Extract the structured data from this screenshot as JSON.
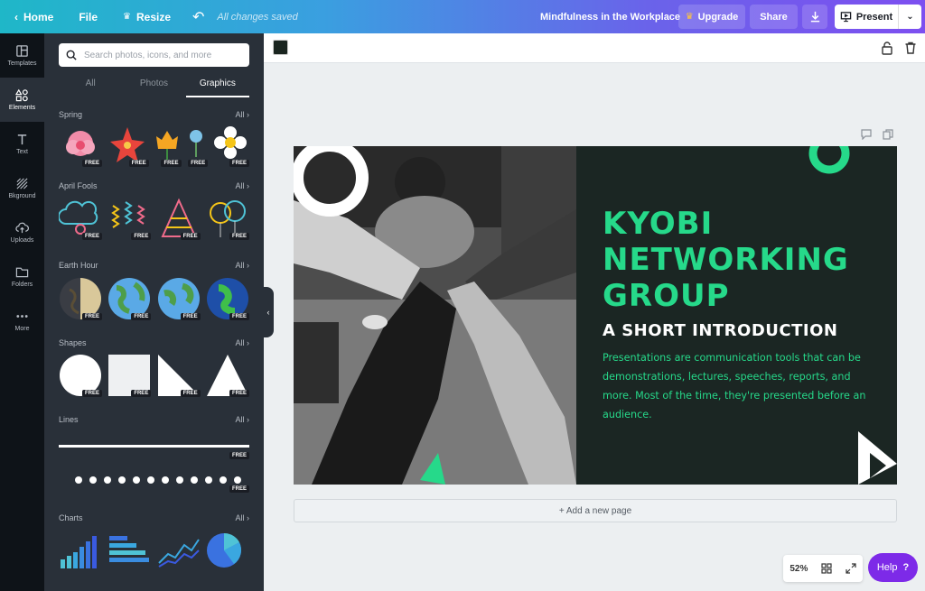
{
  "topbar": {
    "home_label": "Home",
    "file_label": "File",
    "resize_label": "Resize",
    "save_status": "All changes saved",
    "doc_title": "Mindfulness in the Workplace",
    "upgrade_label": "Upgrade",
    "share_label": "Share",
    "present_label": "Present"
  },
  "rail": {
    "items": [
      {
        "label": "Templates",
        "icon": "templates-icon"
      },
      {
        "label": "Elements",
        "icon": "elements-icon"
      },
      {
        "label": "Text",
        "icon": "text-icon"
      },
      {
        "label": "Bkground",
        "icon": "background-icon"
      },
      {
        "label": "Uploads",
        "icon": "upload-icon"
      },
      {
        "label": "Folders",
        "icon": "folder-icon"
      },
      {
        "label": "More",
        "icon": "more-icon"
      }
    ]
  },
  "panel": {
    "search_placeholder": "Search photos, icons, and more",
    "tabs": [
      "All",
      "Photos",
      "Graphics"
    ],
    "all_label": "All",
    "free_label": "FREE",
    "sections": [
      {
        "title": "Spring"
      },
      {
        "title": "April Fools"
      },
      {
        "title": "Earth Hour"
      },
      {
        "title": "Shapes"
      },
      {
        "title": "Lines"
      },
      {
        "title": "Charts"
      }
    ]
  },
  "slide": {
    "title_lines": [
      "KYOBI",
      "NETWORKING",
      "GROUP"
    ],
    "subtitle": "A SHORT INTRODUCTION",
    "body": "Presentations are communication tools that can be demonstrations, lectures, speeches, reports, and more. Most of the time, they're presented before an audience."
  },
  "canvas": {
    "add_page_label": "+ Add a new page",
    "zoom": "52%",
    "help_label": "Help",
    "help_symbol": "?"
  },
  "colors": {
    "accent_green": "#26d98a",
    "slide_dark": "#1b2623",
    "help_purple": "#7d2ae8"
  }
}
